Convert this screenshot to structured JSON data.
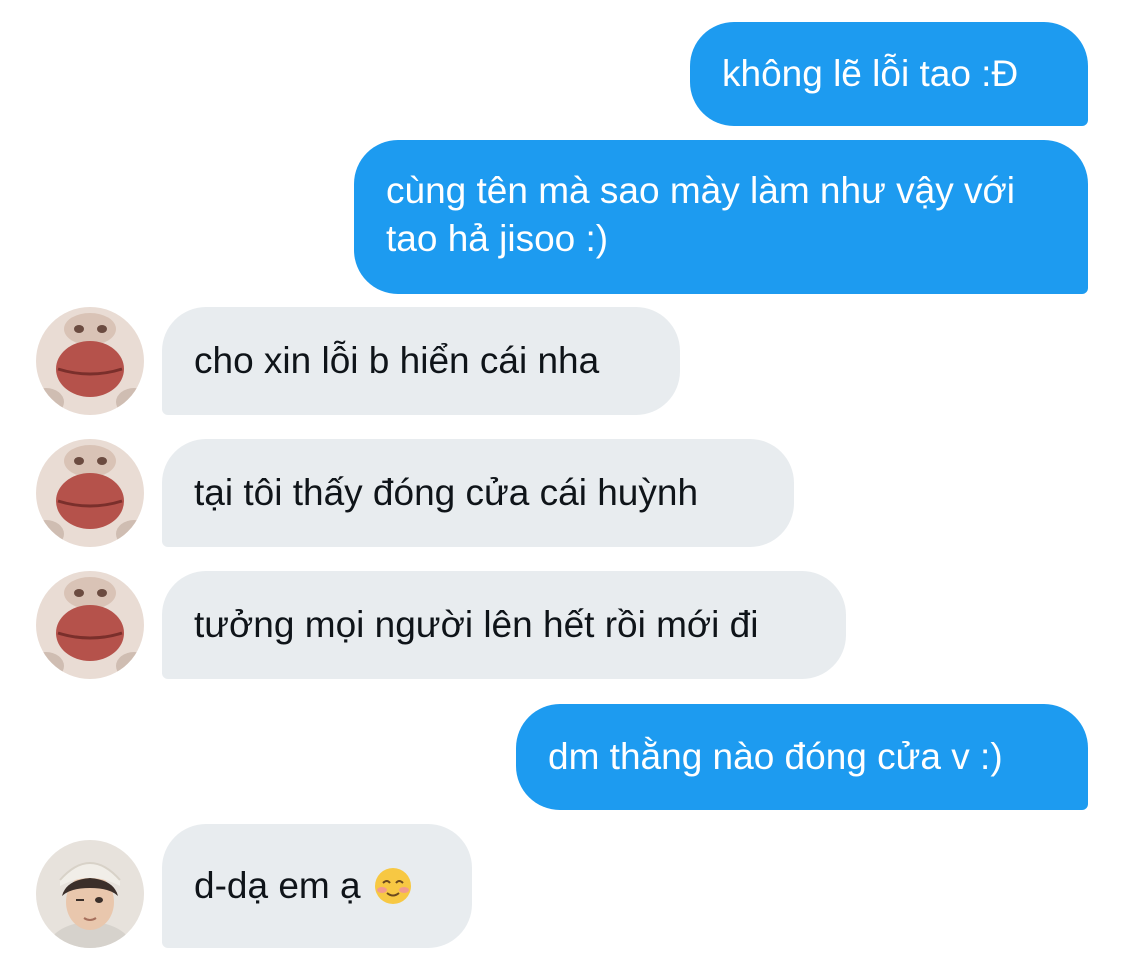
{
  "messages": [
    {
      "sender": "me",
      "text": "không lẽ lỗi tao :Đ"
    },
    {
      "sender": "me",
      "text": "cùng tên mà sao mày làm như vậy với tao hả jisoo :)"
    },
    {
      "sender": "them",
      "text": "cho xin lỗi b hiển cái nha"
    },
    {
      "sender": "them",
      "text": "tại tôi thấy đóng cửa cái huỳnh"
    },
    {
      "sender": "them",
      "text": "tưởng mọi người lên hết rồi mới đi"
    },
    {
      "sender": "me",
      "text": "dm thằng nào đóng cửa v :)"
    },
    {
      "sender": "them2",
      "text": "d-dạ em ạ",
      "emoji": "smiling-face-icon"
    }
  ],
  "colors": {
    "outgoing_bubble": "#1d9bf0",
    "incoming_bubble": "#e8ecef",
    "outgoing_text": "#ffffff",
    "incoming_text": "#0f1419"
  },
  "icons": {
    "avatar_1": "lips-avatar-icon",
    "avatar_2": "person-avatar-icon",
    "emoji": "smiling-face-icon"
  }
}
